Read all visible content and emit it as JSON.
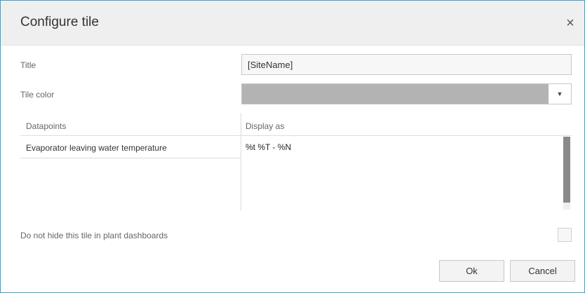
{
  "dialog": {
    "title": "Configure tile",
    "close_icon": "×"
  },
  "form": {
    "title_label": "Title",
    "title_value": "[SiteName]",
    "tile_color_label": "Tile color",
    "tile_color_value": "#b3b3b3",
    "select_arrow": "▼"
  },
  "datapoints": {
    "columns": [
      "Datapoints",
      "Display as"
    ],
    "rows": [
      {
        "name": "Evaporator leaving water temperature",
        "display_as": "%t %T - %N"
      }
    ]
  },
  "options": {
    "hide_label": "Do not hide this tile in plant dashboards",
    "hide_checked": false
  },
  "buttons": {
    "ok": "Ok",
    "cancel": "Cancel"
  },
  "colors": {
    "accent_border": "#2aa8df",
    "header_bg": "#efefef"
  }
}
